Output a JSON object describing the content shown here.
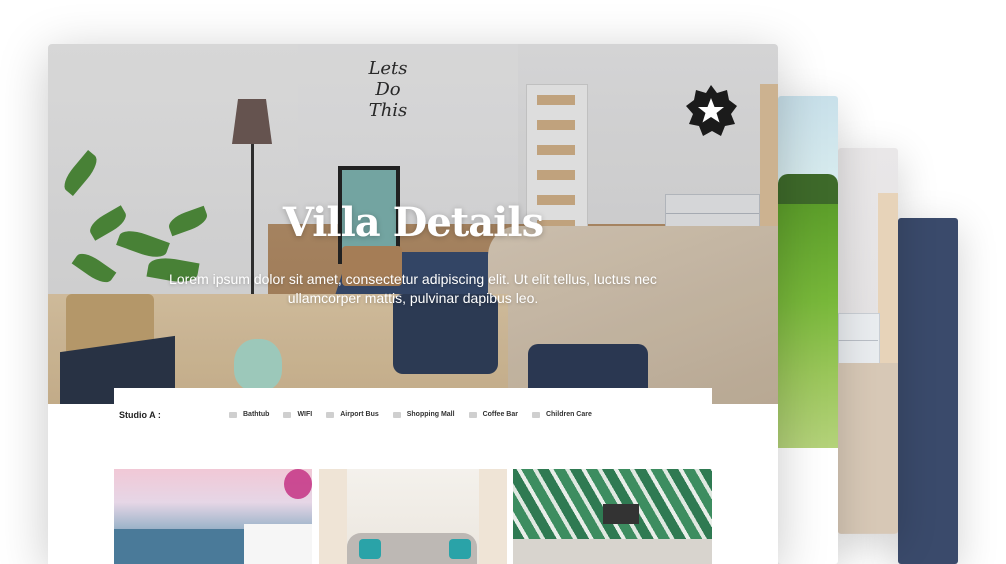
{
  "hero": {
    "title": "Villa Details",
    "description": "Lorem ipsum dolor sit amet, consectetur adipiscing elit. Ut elit tellus, luctus nec ullamcorper mattis, pulvinar dapibus leo.",
    "wall_art_text": [
      "Lets",
      "Do",
      "This"
    ]
  },
  "badge": {
    "icon": "star-badge-icon"
  },
  "amenities": {
    "studio_label": "Studio A :",
    "items": [
      {
        "icon": "bathtub-icon",
        "label": "Bathtub"
      },
      {
        "icon": "wifi-icon",
        "label": "WIFI"
      },
      {
        "icon": "bus-icon",
        "label": "Airport Bus"
      },
      {
        "icon": "shopping-icon",
        "label": "Shopping Mall"
      },
      {
        "icon": "coffee-icon",
        "label": "Coffee Bar"
      },
      {
        "icon": "child-icon",
        "label": "Children Care"
      }
    ]
  },
  "gallery": [
    {
      "name": "seaside-photo"
    },
    {
      "name": "living-room-photo"
    },
    {
      "name": "tropical-room-photo"
    }
  ],
  "colors": {
    "navy_card": "#3a4a6b",
    "badge": "#1b1b1b",
    "text_white": "#ffffff"
  }
}
